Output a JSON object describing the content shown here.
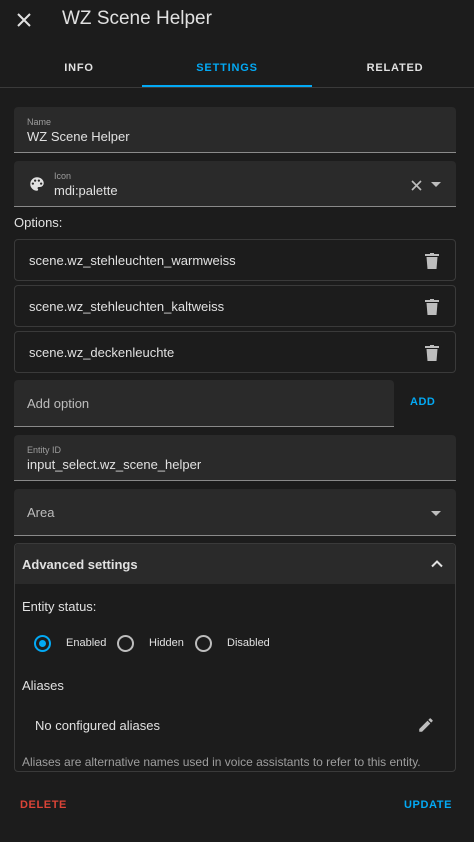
{
  "header": {
    "title": "WZ Scene Helper"
  },
  "tabs": [
    {
      "label": "INFO"
    },
    {
      "label": "SETTINGS"
    },
    {
      "label": "RELATED"
    }
  ],
  "name_field": {
    "label": "Name",
    "value": "WZ Scene Helper"
  },
  "icon_field": {
    "label": "Icon",
    "value": "mdi:palette",
    "icon": "palette-icon"
  },
  "options": {
    "title": "Options:",
    "items": [
      {
        "label": "scene.wz_stehleuchten_warmweiss"
      },
      {
        "label": "scene.wz_stehleuchten_kaltweiss"
      },
      {
        "label": "scene.wz_deckenleuchte"
      }
    ],
    "add_placeholder": "Add option",
    "add_label": "ADD"
  },
  "entity_id_field": {
    "label": "Entity ID",
    "value": "input_select.wz_scene_helper"
  },
  "area_field": {
    "placeholder": "Area"
  },
  "advanced": {
    "title": "Advanced settings",
    "entity_status_title": "Entity status:",
    "radios": [
      {
        "label": "Enabled",
        "checked": true
      },
      {
        "label": "Hidden",
        "checked": false
      },
      {
        "label": "Disabled",
        "checked": false
      }
    ],
    "aliases_title": "Aliases",
    "no_aliases": "No configured aliases",
    "helper_text": "Aliases are alternative names used in voice assistants to refer to this entity."
  },
  "footer": {
    "delete_label": "DELETE",
    "update_label": "UPDATE"
  },
  "colors": {
    "accent": "#03a9f4",
    "danger": "#db4437",
    "background": "#1c1c1c",
    "surface": "#2a2a2a"
  }
}
